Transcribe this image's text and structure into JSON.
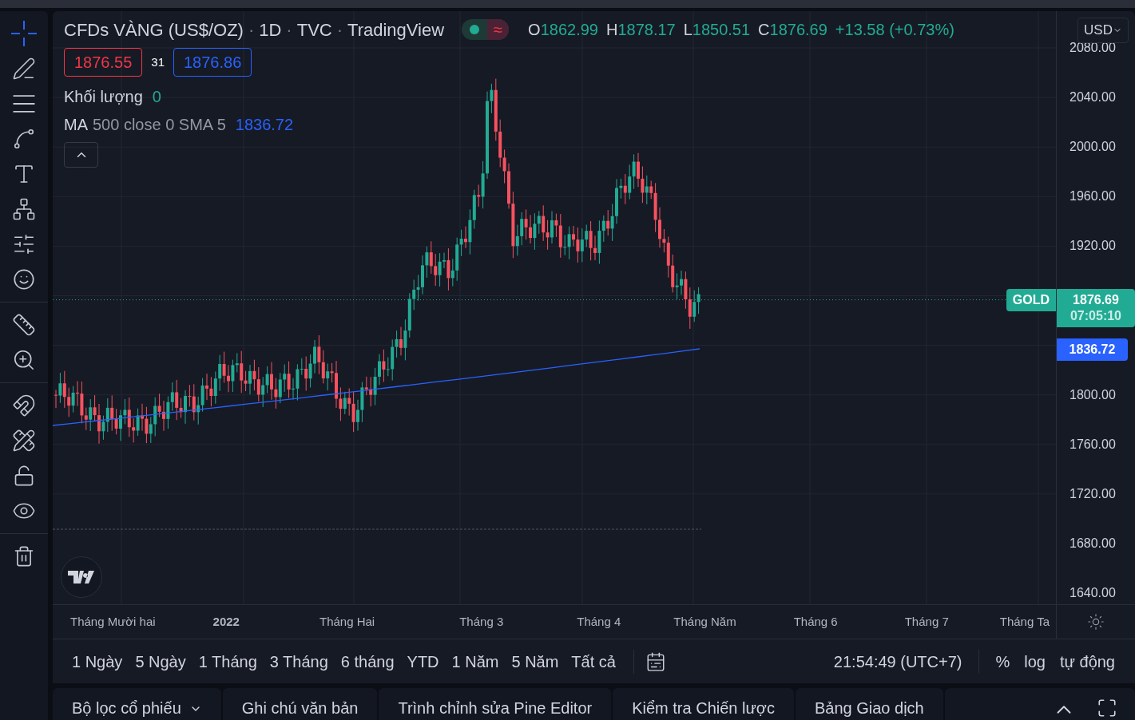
{
  "header": {
    "symbol": "CFDs VÀNG (US$/OZ)",
    "interval": "1D",
    "exchange": "TVC",
    "source": "TradingView",
    "separator": "·",
    "status_icon": "≈",
    "ohlc": [
      {
        "label": "O",
        "value": "1862.99"
      },
      {
        "label": "H",
        "value": "1878.17"
      },
      {
        "label": "L",
        "value": "1850.51"
      },
      {
        "label": "C",
        "value": "1876.69"
      }
    ],
    "change": "+13.58 (+0.73%)"
  },
  "currency": "USD",
  "quote": {
    "sell": "1876.55",
    "spread": "31",
    "buy": "1876.86"
  },
  "volume": {
    "label": "Khối lượng",
    "value": "0"
  },
  "ma": {
    "name": "MA",
    "params": "500 close 0 SMA 5",
    "value": "1836.72"
  },
  "price_axis": [
    "2080.00",
    "2040.00",
    "2000.00",
    "1960.00",
    "1920.00",
    "1800.00",
    "1760.00",
    "1720.00",
    "1680.00",
    "1640.00"
  ],
  "price_tags": {
    "symbol": "GOLD",
    "last": "1876.69",
    "countdown": "07:05:10",
    "ma": "1836.72"
  },
  "time_axis": [
    {
      "label": "Tháng Mười hai",
      "bold": false
    },
    {
      "label": "2022",
      "bold": true
    },
    {
      "label": "Tháng Hai",
      "bold": false
    },
    {
      "label": "Tháng 3",
      "bold": false
    },
    {
      "label": "Tháng 4",
      "bold": false
    },
    {
      "label": "Tháng Năm",
      "bold": false
    },
    {
      "label": "Tháng 6",
      "bold": false
    },
    {
      "label": "Tháng 7",
      "bold": false
    },
    {
      "label": "Tháng Ta",
      "bold": false
    }
  ],
  "ranges": [
    "1 Ngày",
    "5 Ngày",
    "1 Tháng",
    "3 Tháng",
    "6 tháng",
    "YTD",
    "1 Năm",
    "5 Năm",
    "Tất cả"
  ],
  "clock": "21:54:49 (UTC+7)",
  "scale_options": [
    "%",
    "log",
    "tự động"
  ],
  "bottom_tabs": [
    {
      "label": "Bộ lọc cổ phiếu",
      "dropdown": true
    },
    {
      "label": "Ghi chú văn bản",
      "dropdown": false
    },
    {
      "label": "Trình chỉnh sửa Pine Editor",
      "dropdown": false
    },
    {
      "label": "Kiểm tra Chiến lược",
      "dropdown": false
    },
    {
      "label": "Bảng Giao dịch",
      "dropdown": false
    }
  ]
}
